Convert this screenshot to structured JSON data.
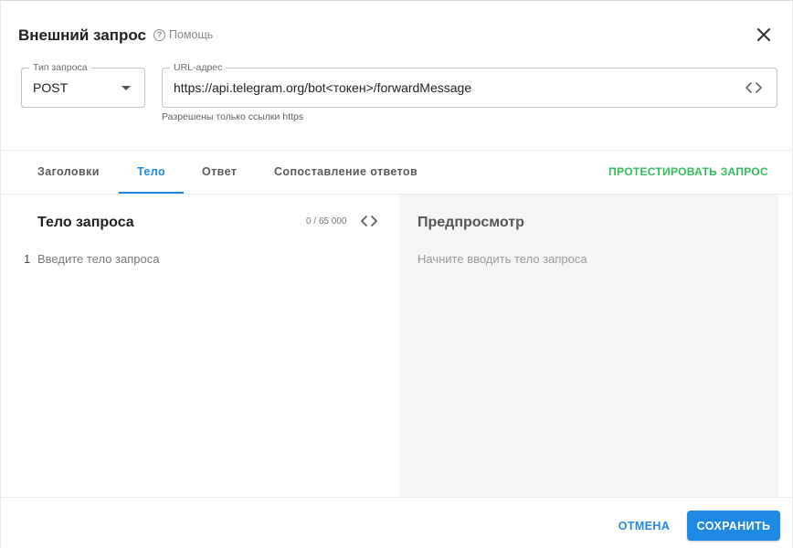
{
  "dialog": {
    "title": "Внешний запрос",
    "help_label": "Помощь",
    "help_icon": "question-circle-icon",
    "close_icon": "close-icon"
  },
  "request_type": {
    "legend": "Тип запроса",
    "value": "POST",
    "icon": "dropdown-arrow-icon"
  },
  "url": {
    "legend": "URL-адрес",
    "value": "https://api.telegram.org/bot<токен>/forwardMessage",
    "helper": "Разрешены только ссылки https",
    "icon": "code-icon"
  },
  "tabs": [
    {
      "label": "Заголовки",
      "active": false
    },
    {
      "label": "Тело",
      "active": true
    },
    {
      "label": "Ответ",
      "active": false
    },
    {
      "label": "Сопоставление ответов",
      "active": false
    }
  ],
  "test_button": "ПРОТЕСТИРОВАТЬ ЗАПРОС",
  "body": {
    "title": "Тело запроса",
    "counter": "0 / 65 000",
    "line_number": "1",
    "placeholder": "Введите тело запроса"
  },
  "preview": {
    "title": "Предпросмотр",
    "placeholder": "Начните вводить тело запроса"
  },
  "footer": {
    "cancel_label": "ОТМЕНА",
    "save_label": "СОХРАНИТЬ"
  },
  "colors": {
    "accent": "#1e88e5",
    "test": "#2ebd59",
    "preview_bg": "#f5f5f5"
  }
}
